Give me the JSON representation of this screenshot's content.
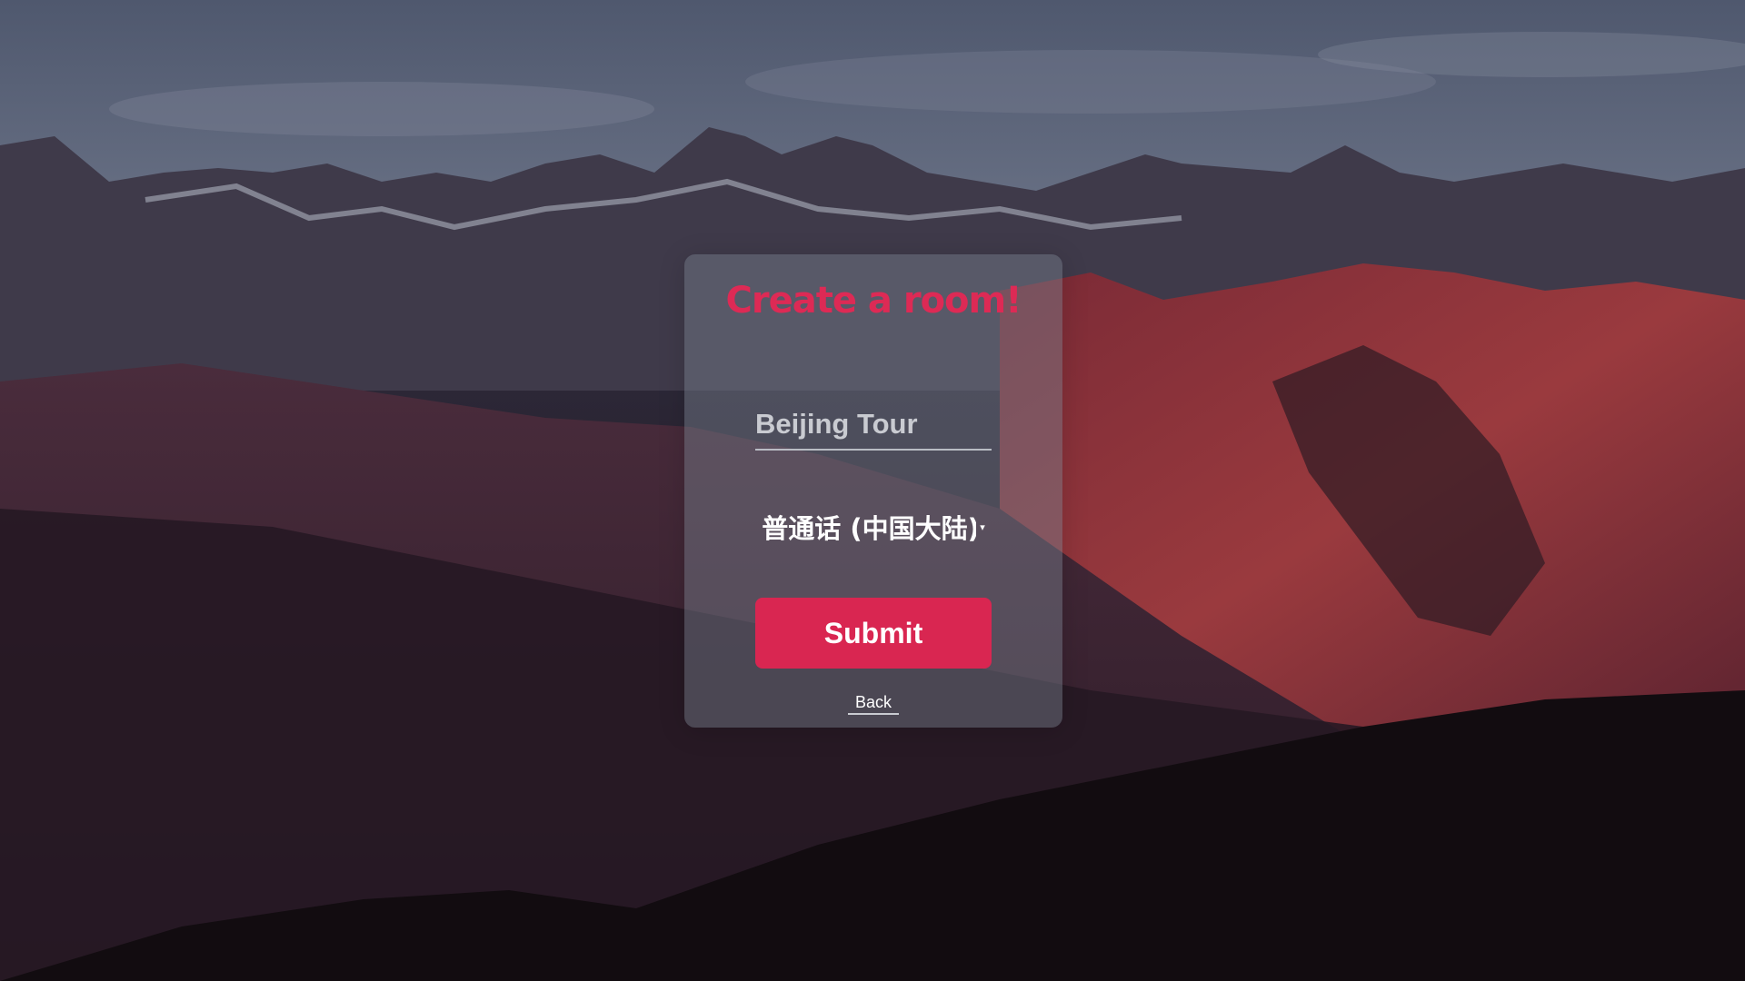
{
  "page": {
    "title": "Create a room!",
    "room_name_value": "Beijing Tour",
    "language_selected": "普通话 (中国大陆)",
    "submit_label": "Submit",
    "back_label": "Back"
  },
  "colors": {
    "accent": "#d92651",
    "title": "#dd2a55",
    "card_bg": "rgba(120,128,142,0.45)"
  },
  "icons": {
    "dropdown": "chevron-down-icon"
  },
  "background": {
    "image": "mountain landscape at dusk"
  }
}
